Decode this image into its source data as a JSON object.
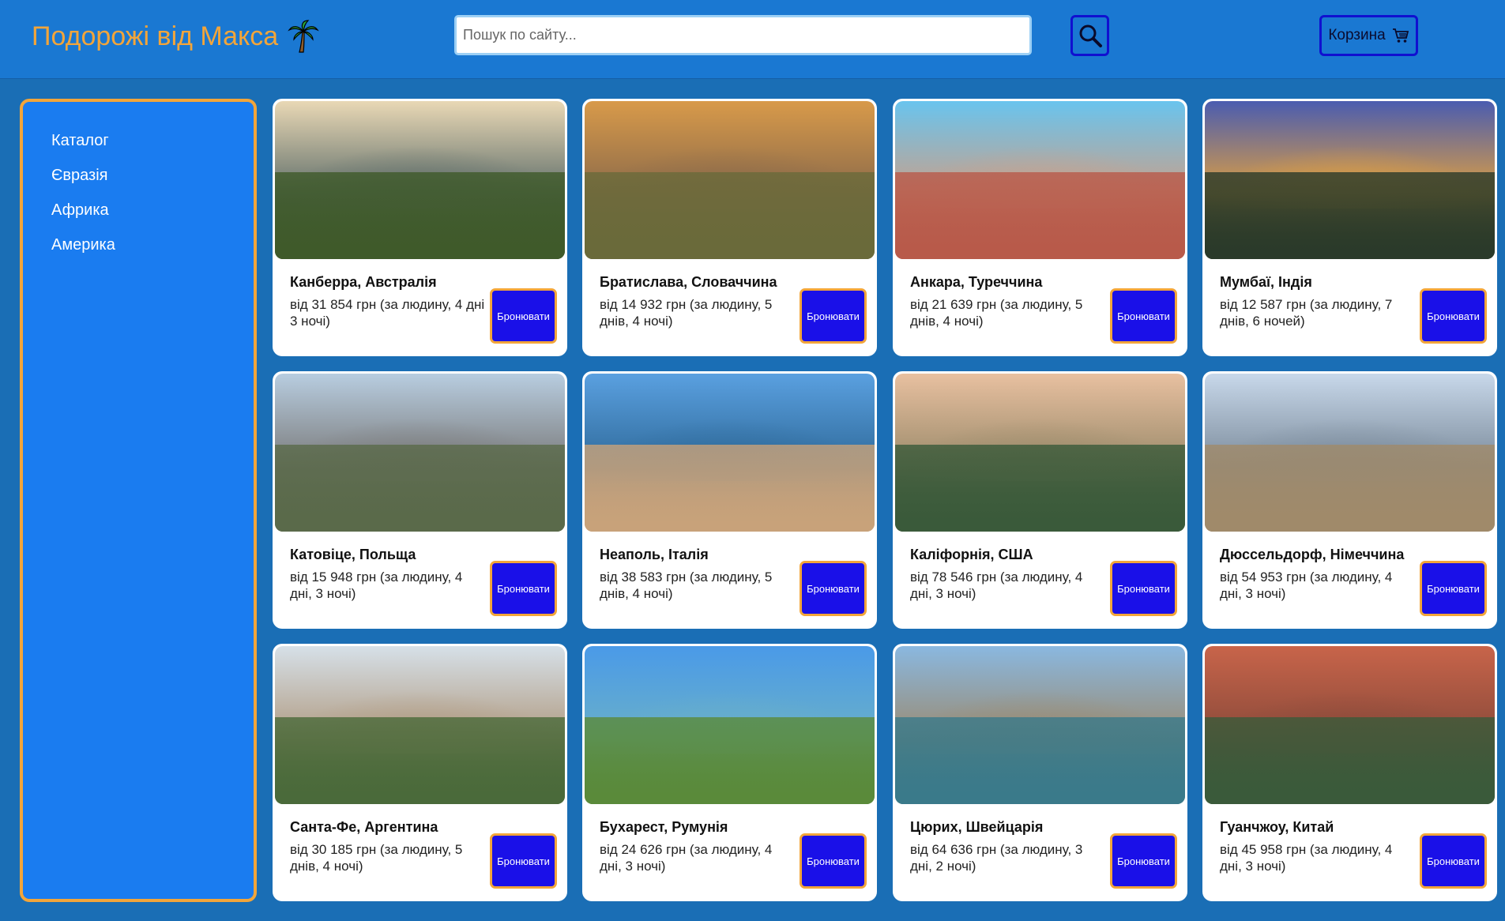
{
  "header": {
    "logo_text": "Подорожі від Макса",
    "search_placeholder": "Пошук по сайту...",
    "cart_label": "Корзина"
  },
  "sidebar": {
    "items": [
      {
        "label": "Каталог"
      },
      {
        "label": "Євразія"
      },
      {
        "label": "Африка"
      },
      {
        "label": "Америка"
      }
    ]
  },
  "tours": [
    {
      "title": "Канберра, Австралія",
      "price": "від 31 854 грн (за людину, 4 дні 3 ночі)",
      "button": "Бронювати",
      "palette": [
        "#e9d8b5",
        "#3f5a2a",
        "#5f6e6a"
      ]
    },
    {
      "title": "Братислава, Словаччина",
      "price": "від 14 932 грн (за людину, 5 днів, 4 ночі)",
      "button": "Бронювати",
      "palette": [
        "#d89a4a",
        "#6a6a3a",
        "#8b6a4a"
      ]
    },
    {
      "title": "Анкара, Туреччина",
      "price": "від 21 639 грн (за людину, 5 днів, 4 ночі)",
      "button": "Бронювати",
      "palette": [
        "#69c4ee",
        "#b85a4a",
        "#c9a08a"
      ]
    },
    {
      "title": "Мумбаї, Індія",
      "price": "від 12 587 грн (за людину, 7 днів, 6 ночей)",
      "button": "Бронювати",
      "palette": [
        "#4a5cb0",
        "#2a3a2a",
        "#e0a040"
      ]
    },
    {
      "title": "Катовіце, Польща",
      "price": "від 15 948 грн (за людину, 4 дні, 3 ночі)",
      "button": "Бронювати",
      "palette": [
        "#b8cde0",
        "#5a6a4a",
        "#7a7a7a"
      ]
    },
    {
      "title": "Неаполь, Італія",
      "price": "від 38 583 грн (за людину, 5 днів, 4 ночі)",
      "button": "Бронювати",
      "palette": [
        "#5aa0e0",
        "#c8a27a",
        "#2f6a9a"
      ]
    },
    {
      "title": "Каліфорнія, США",
      "price": "від 78 546 грн (за людину, 4 дні, 3 ночі)",
      "button": "Бронювати",
      "palette": [
        "#e8c0a0",
        "#3a5a3a",
        "#9a8a6a"
      ]
    },
    {
      "title": "Дюссельдорф, Німеччина",
      "price": "від 54 953 грн (за людину, 4 дні, 3 ночі)",
      "button": "Бронювати",
      "palette": [
        "#c8d8ea",
        "#a08a6a",
        "#7a8a9a"
      ]
    },
    {
      "title": "Санта-Фе, Аргентина",
      "price": "від 30 185 грн (за людину, 5 днів, 4 ночі)",
      "button": "Бронювати",
      "palette": [
        "#d6e0e8",
        "#4a6a3a",
        "#b09a80"
      ]
    },
    {
      "title": "Бухарест, Румунія",
      "price": "від 24 626 грн (за людину, 4 дні, 3 ночі)",
      "button": "Бронювати",
      "palette": [
        "#4a9ae8",
        "#5a8a3a",
        "#6ab0c8"
      ]
    },
    {
      "title": "Цюрих, Швейцарія",
      "price": "від 64 636 грн (за людину, 3 дні, 2 ночі)",
      "button": "Бронювати",
      "palette": [
        "#8ab8e0",
        "#3a7a8a",
        "#9a8a70"
      ]
    },
    {
      "title": "Гуанчжоу, Китай",
      "price": "від 45 958 грн (за людину, 4 дні, 3 ночі)",
      "button": "Бронювати",
      "palette": [
        "#c8644a",
        "#3a5a3a",
        "#8a4a3a"
      ]
    }
  ]
}
